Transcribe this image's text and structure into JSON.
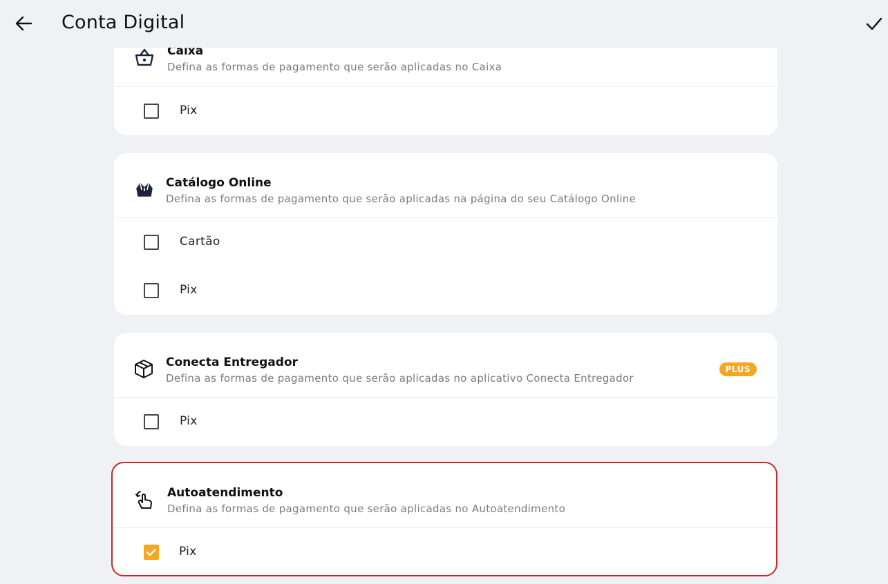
{
  "header": {
    "title": "Conta Digital",
    "back_icon": "arrow-left-icon",
    "confirm_icon": "check-icon"
  },
  "colors": {
    "accent": "#f5a623",
    "highlight_border": "#c62828",
    "background": "#f0f1f5"
  },
  "sections": [
    {
      "icon": "basket-icon",
      "title": "Caixa",
      "description": "Defina as formas de pagamento que serão aplicadas no Caixa",
      "options": [
        {
          "label": "Pix",
          "checked": false
        }
      ]
    },
    {
      "icon": "store-crown-icon",
      "title": "Catálogo Online",
      "description": "Defina as formas de pagamento que serão aplicadas na página do seu Catálogo Online",
      "options": [
        {
          "label": "Cartão",
          "checked": false
        },
        {
          "label": "Pix",
          "checked": false
        }
      ]
    },
    {
      "icon": "package-box-icon",
      "title": "Conecta Entregador",
      "description": "Defina as formas de pagamento que serão aplicadas no aplicativo Conecta Entregador",
      "badge": "PLUS",
      "options": [
        {
          "label": "Pix",
          "checked": false
        }
      ]
    },
    {
      "icon": "touch-hand-icon",
      "title": "Autoatendimento",
      "description": "Defina as formas de pagamento que serão aplicadas no Autoatendimento",
      "options": [
        {
          "label": "Pix",
          "checked": true
        }
      ]
    }
  ]
}
